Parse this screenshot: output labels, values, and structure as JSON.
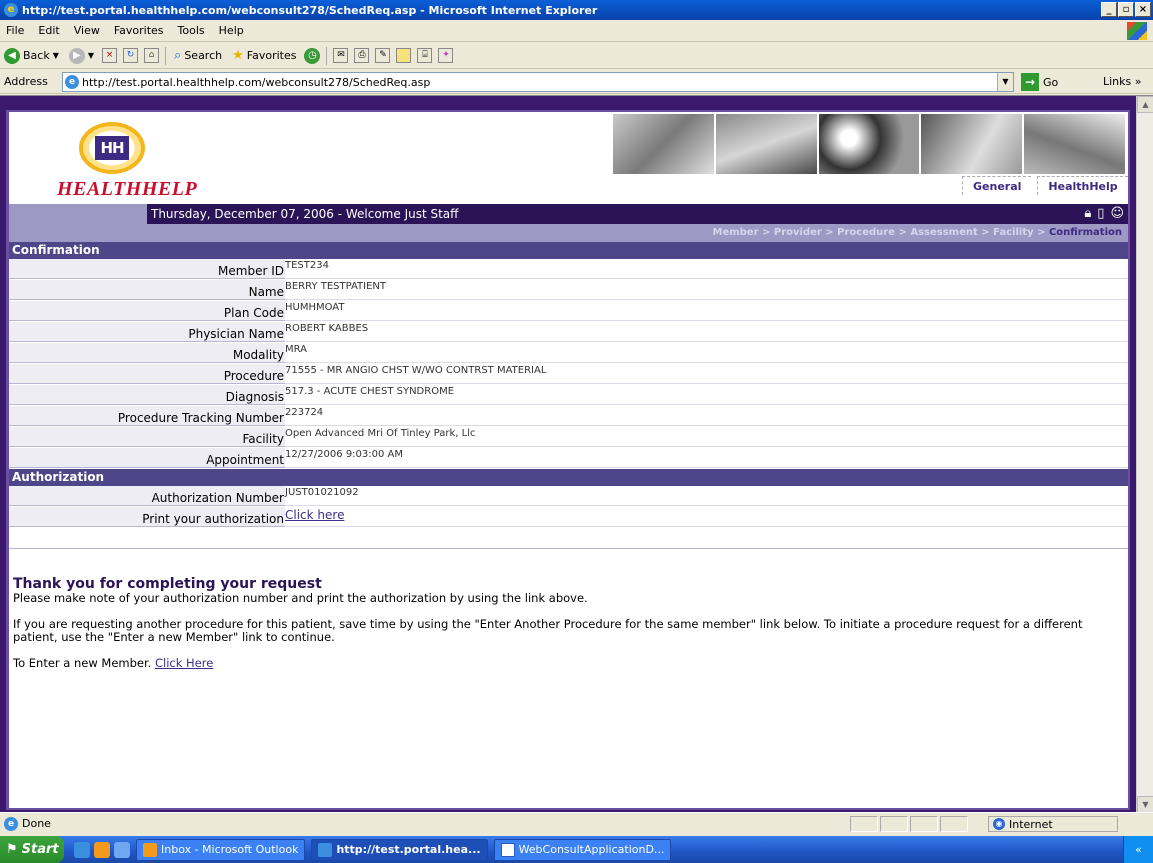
{
  "window": {
    "title": "http://test.portal.healthhelp.com/webconsult278/SchedReq.asp - Microsoft Internet Explorer"
  },
  "menu": [
    "File",
    "Edit",
    "View",
    "Favorites",
    "Tools",
    "Help"
  ],
  "toolbar": {
    "back": "Back",
    "search": "Search",
    "favorites": "Favorites"
  },
  "address": {
    "label": "Address",
    "url": "http://test.portal.healthhelp.com/webconsult278/SchedReq.asp",
    "go": "Go",
    "links": "Links »"
  },
  "header": {
    "logo_text": "HEALTHHELP",
    "logo_mark": "HH",
    "nav_general": "General",
    "nav_healthhelp": "HealthHelp",
    "welcome": "Thursday, December 07, 2006 - Welcome Just Staff"
  },
  "breadcrumb": {
    "trail": "Member > Provider > Procedure > Assessment > Facility > ",
    "current": "Confirmation"
  },
  "confirmation": {
    "heading": "Confirmation",
    "rows": [
      {
        "label": "Member ID",
        "value": "TEST234"
      },
      {
        "label": "Name",
        "value": "BERRY TESTPATIENT"
      },
      {
        "label": "Plan Code",
        "value": "HUMHMOAT"
      },
      {
        "label": "Physician Name",
        "value": "ROBERT KABBES"
      },
      {
        "label": "Modality",
        "value": "MRA"
      },
      {
        "label": "Procedure",
        "value": "71555 - MR ANGIO CHST W/WO CONTRST MATERIAL"
      },
      {
        "label": "Diagnosis",
        "value": "517.3 - ACUTE CHEST SYNDROME"
      },
      {
        "label": "Procedure Tracking Number",
        "value": "223724"
      },
      {
        "label": "Facility",
        "value": "Open Advanced Mri Of Tinley Park, Llc"
      },
      {
        "label": "Appointment",
        "value": "12/27/2006 9:03:00 AM"
      }
    ]
  },
  "authorization": {
    "heading": "Authorization",
    "number_label": "Authorization Number",
    "number_value": "JUST01021092",
    "print_label": "Print your authorization",
    "print_link": "Click here"
  },
  "thanks": {
    "title": "Thank you for completing your request",
    "line1": "Please make note of your authorization number and print the authorization by using the link above.",
    "line2": "If you are requesting another procedure for this patient, save time by using the \"Enter Another Procedure for the same member\" link below. To initiate a procedure request for a different patient, use the \"Enter a new Member\" link to continue.",
    "new_member_text": "To Enter a new Member.",
    "new_member_link": "Click Here"
  },
  "status": {
    "text": "Done",
    "zone": "Internet"
  },
  "taskbar": {
    "start": "Start",
    "tasks": [
      "Inbox - Microsoft Outlook",
      "http://test.portal.hea...",
      "WebConsultApplicationD..."
    ],
    "tray": "«"
  },
  "colors": {
    "brand_purple": "#2b1358",
    "section_header": "#4e4688",
    "logo_red": "#c8102e",
    "logo_gold": "#f2b51c"
  }
}
